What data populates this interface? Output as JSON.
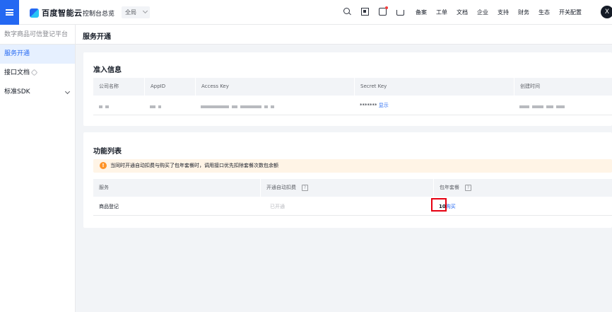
{
  "topbar": {
    "brand": "百度智能云",
    "console_link": "控制台总览",
    "region": "全局",
    "icons": [
      "search-icon",
      "qr-code-icon",
      "message-icon",
      "cart-icon"
    ],
    "nav": [
      "备案",
      "工单",
      "文档",
      "企业",
      "支持",
      "财务",
      "生态",
      "开关配置"
    ],
    "avatar_letter": "X"
  },
  "sidebar": {
    "title": "数字商品可信登记平台",
    "items": [
      {
        "label": "服务开通",
        "active": true
      },
      {
        "label": "接口文档",
        "external": true
      },
      {
        "label": "标准SDK",
        "expandable": true
      }
    ]
  },
  "page": {
    "title": "服务开通"
  },
  "access_card": {
    "title": "准入信息",
    "columns": [
      "公司名称",
      "AppID",
      "Access Key",
      "Secret Key",
      "创建时间"
    ],
    "row": {
      "secret_masked": "*******",
      "show_link": "显示"
    }
  },
  "function_card": {
    "title": "功能列表",
    "notice": "当同时开通自动扣费与购买了包年套餐时，调用接口优先扣除套餐次数包余额",
    "columns": [
      "服务",
      "开通自动扣费",
      "包年套餐"
    ],
    "help_mark": "?",
    "rows": [
      {
        "service": "商品登记",
        "auto_deduct": "已开通",
        "package_count": "10",
        "buy_link": "购买"
      }
    ]
  },
  "colors": {
    "accent": "#2468f2",
    "warning": "#ff9326",
    "highlight_box": "#e60012"
  }
}
